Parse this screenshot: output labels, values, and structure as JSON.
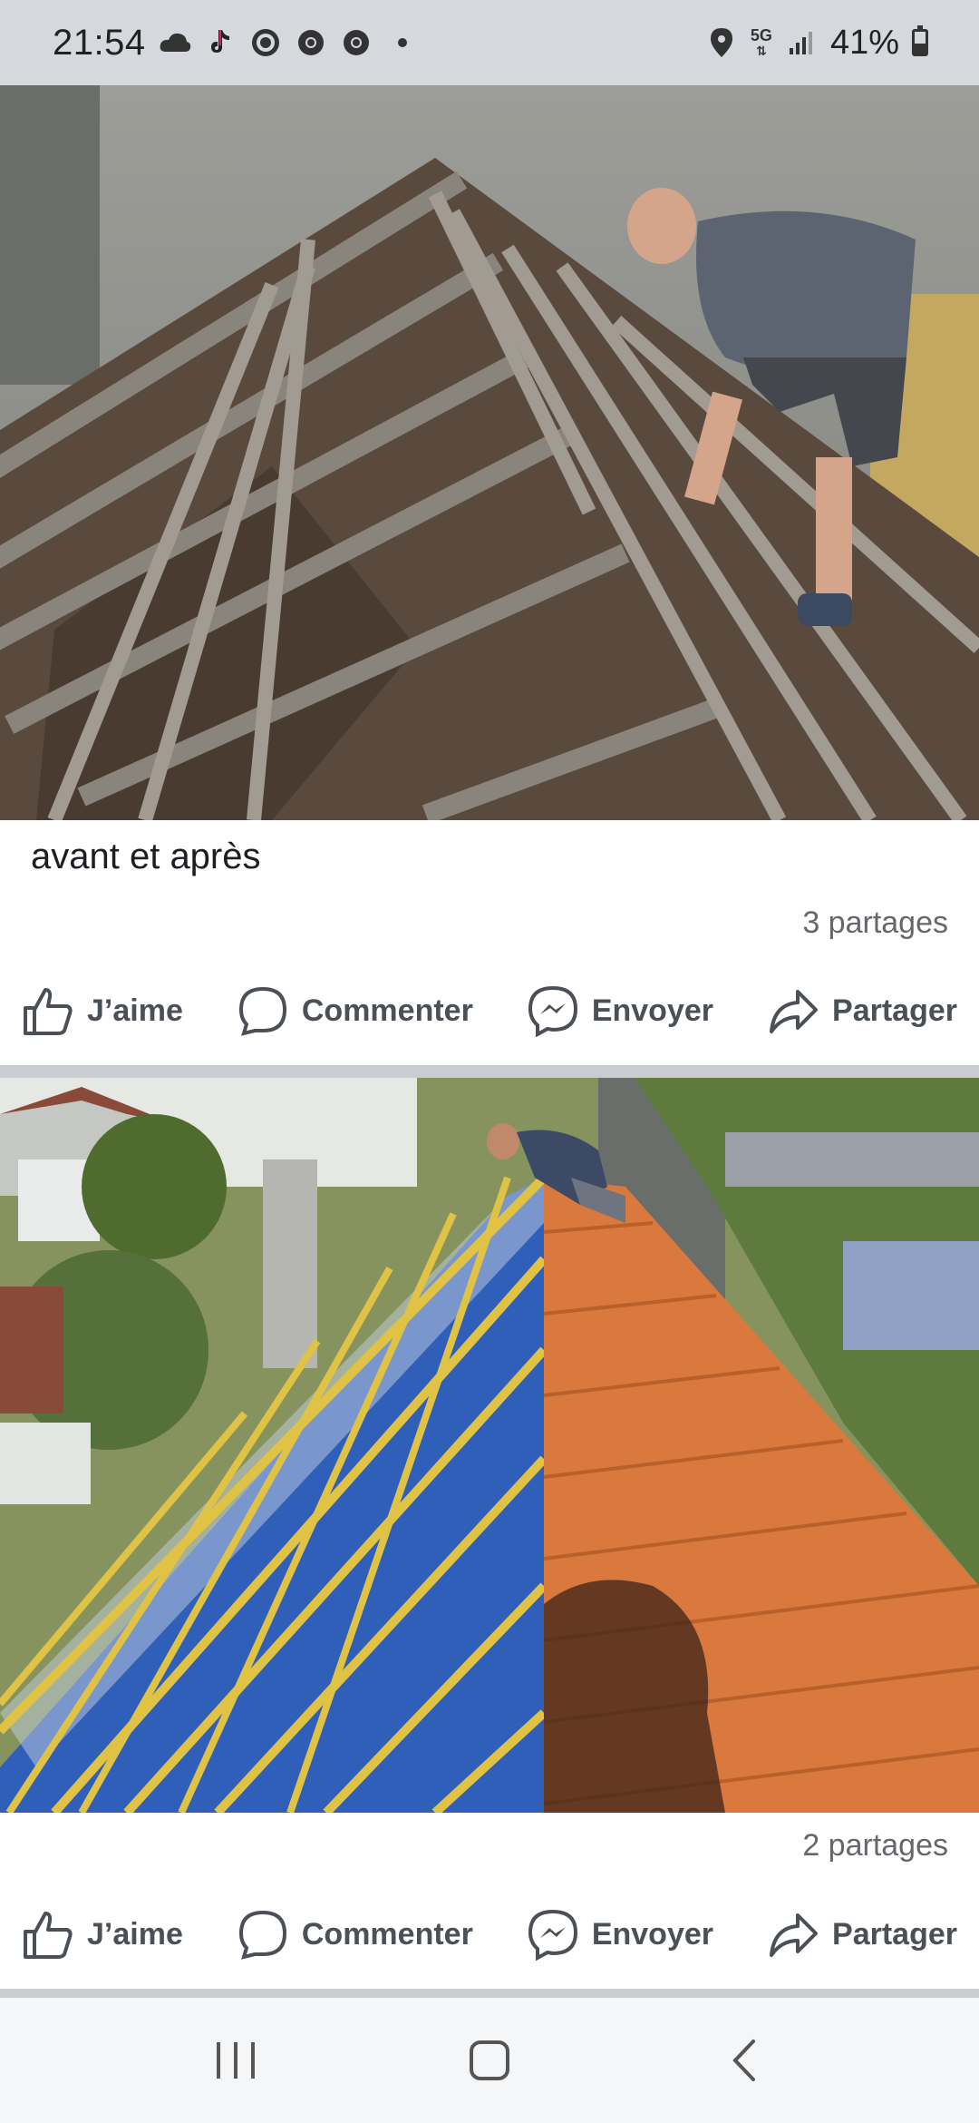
{
  "status_bar": {
    "time": "21:54",
    "notification_icons": [
      "cloud-icon",
      "tiktok-icon",
      "target-icon",
      "chrome-icon",
      "chrome-icon"
    ],
    "network": "5G",
    "battery": "41%"
  },
  "posts": [
    {
      "caption": "avant et après",
      "shares": "3 partages",
      "actions": {
        "like": "J’aime",
        "comment": "Commenter",
        "send": "Envoyer",
        "share": "Partager"
      }
    },
    {
      "shares": "2 partages",
      "actions": {
        "like": "J’aime",
        "comment": "Commenter",
        "send": "Envoyer",
        "share": "Partager"
      }
    }
  ],
  "colors": {
    "status_bar_bg": "#d5d8dd",
    "divider": "#c9ccd1",
    "action_text": "#4b4f56",
    "tile_orange": "#d9793d",
    "membrane_blue": "#2f5fb8"
  }
}
